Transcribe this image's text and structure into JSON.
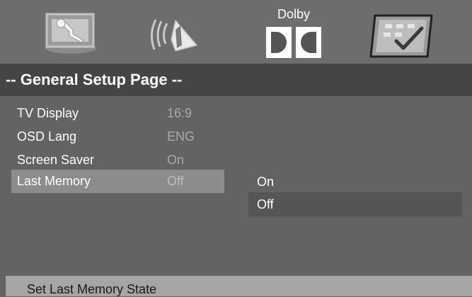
{
  "icon_bar": {
    "icons": [
      {
        "name": "general-setup-icon"
      },
      {
        "name": "audio-setup-icon"
      },
      {
        "name": "dolby-setup-icon",
        "text": "Dolby"
      },
      {
        "name": "preference-setup-icon"
      }
    ],
    "active_index": 3
  },
  "header": {
    "title": "-- General Setup Page --"
  },
  "menu": {
    "items": [
      {
        "label": "TV Display",
        "value": "16:9"
      },
      {
        "label": "OSD Lang",
        "value": "ENG"
      },
      {
        "label": "Screen Saver",
        "value": "On"
      },
      {
        "label": "Last Memory",
        "value": "Off"
      }
    ],
    "selected_index": 3
  },
  "options": {
    "items": [
      {
        "label": "On"
      },
      {
        "label": "Off"
      }
    ],
    "selected_index": 1
  },
  "status": {
    "text": "Set Last Memory State"
  },
  "colors": {
    "background": "#636363",
    "icon_bar": "#6d6d6d",
    "header_bar": "#454545",
    "menu_highlight": "#8c8c8c",
    "option_highlight": "#555555",
    "status_bar": "#a5a5a5"
  }
}
